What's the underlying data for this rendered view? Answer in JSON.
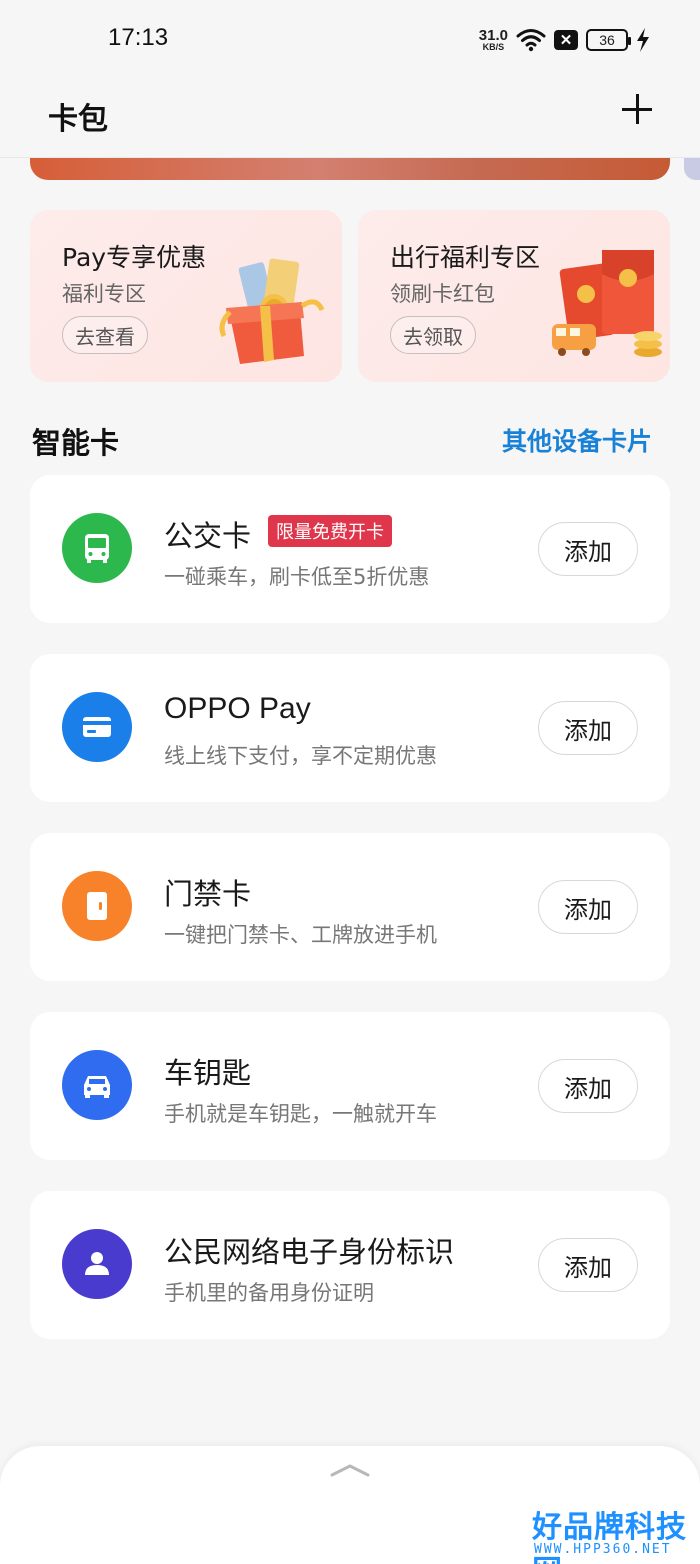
{
  "status_bar": {
    "time": "17:13",
    "net_speed": "31.0",
    "net_unit": "KB/S",
    "sim_glyph": "✕",
    "battery_level": "36",
    "icons": [
      "wifi-icon",
      "sim-disabled-icon",
      "battery-icon",
      "charging-bolt-icon"
    ]
  },
  "header": {
    "title": "卡包",
    "add_icon": "plus-icon"
  },
  "promos": [
    {
      "title": "Pay专享优惠",
      "subtitle": "福利专区",
      "button": "去查看",
      "art_icon": "gift-box-icon"
    },
    {
      "title": "出行福利专区",
      "subtitle": "领刷卡红包",
      "button": "去领取",
      "art_icon": "red-envelope-icon"
    }
  ],
  "section": {
    "title": "智能卡",
    "link": "其他设备卡片"
  },
  "cards": [
    {
      "title": "公交卡",
      "badge": "限量免费开卡",
      "desc": "一碰乘车，刷卡低至5折优惠",
      "button": "添加",
      "icon": "bus-icon",
      "color": "#2db84d"
    },
    {
      "title": "OPPO Pay",
      "desc": "线上线下支付，享不定期优惠",
      "button": "添加",
      "icon": "credit-card-icon",
      "color": "#1a7fe8"
    },
    {
      "title": "门禁卡",
      "desc": "一键把门禁卡、工牌放进手机",
      "button": "添加",
      "icon": "door-icon",
      "color": "#f7822a"
    },
    {
      "title": "车钥匙",
      "desc": "手机就是车钥匙，一触就开车",
      "button": "添加",
      "icon": "car-icon",
      "color": "#2f6cf0"
    },
    {
      "title": "公民网络电子身份标识",
      "desc": "手机里的备用身份证明",
      "button": "添加",
      "icon": "person-icon",
      "color": "#4a3bcf"
    }
  ],
  "bottom_sheet": {
    "handle_icon": "chevron-up-icon"
  },
  "watermark": {
    "main": "好品牌科技网",
    "sub": "WWW.HPP360.NET"
  }
}
